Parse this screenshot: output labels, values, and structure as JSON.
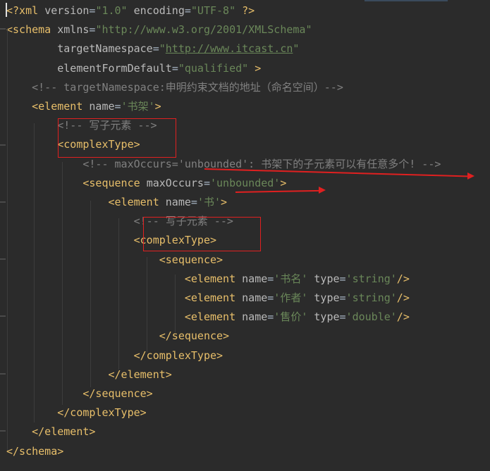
{
  "editor": {
    "language": "xml",
    "lines": [
      {
        "parts": [
          {
            "t": "<?xml ",
            "c": "pi"
          },
          {
            "t": "version",
            "c": "attr"
          },
          {
            "t": "=",
            "c": "plain"
          },
          {
            "t": "\"1.0\"",
            "c": "val"
          },
          {
            "t": " encoding",
            "c": "attr"
          },
          {
            "t": "=",
            "c": "plain"
          },
          {
            "t": "\"UTF-8\"",
            "c": "val"
          },
          {
            "t": " ?>",
            "c": "pi"
          }
        ]
      },
      {
        "parts": [
          {
            "t": "<schema ",
            "c": "tag"
          },
          {
            "t": "xmlns",
            "c": "attr"
          },
          {
            "t": "=",
            "c": "plain"
          },
          {
            "t": "\"http://www.w3.org/2001/XMLSchema\"",
            "c": "val"
          }
        ]
      },
      {
        "parts": [
          {
            "t": "        targetNamespace",
            "c": "attr"
          },
          {
            "t": "=",
            "c": "plain"
          },
          {
            "t": "\"",
            "c": "val"
          },
          {
            "t": "http://www.itcast.cn",
            "c": "link"
          },
          {
            "t": "\"",
            "c": "val"
          }
        ]
      },
      {
        "parts": [
          {
            "t": "        elementFormDefault",
            "c": "attr"
          },
          {
            "t": "=",
            "c": "plain"
          },
          {
            "t": "\"qualified\"",
            "c": "val"
          },
          {
            "t": " >",
            "c": "tag"
          }
        ]
      },
      {
        "parts": [
          {
            "t": "    <!-- targetNamespace:申明约束文档的地址（命名空间）-->",
            "c": "cmt"
          }
        ]
      },
      {
        "parts": [
          {
            "t": "    <element ",
            "c": "tag"
          },
          {
            "t": "name",
            "c": "attr"
          },
          {
            "t": "=",
            "c": "plain"
          },
          {
            "t": "'书架'",
            "c": "val"
          },
          {
            "t": ">",
            "c": "tag"
          }
        ]
      },
      {
        "parts": [
          {
            "t": "        <!-- 写子元素 -->",
            "c": "cmt"
          }
        ]
      },
      {
        "parts": [
          {
            "t": "        <complexType>",
            "c": "tag"
          }
        ]
      },
      {
        "parts": [
          {
            "t": "            <!-- maxOccurs='unbounded': 书架下的子元素可以有任意多个! -->",
            "c": "cmt"
          }
        ]
      },
      {
        "parts": [
          {
            "t": "            <sequence ",
            "c": "tag"
          },
          {
            "t": "maxOccurs",
            "c": "attr"
          },
          {
            "t": "=",
            "c": "plain"
          },
          {
            "t": "'unbounded'",
            "c": "val"
          },
          {
            "t": ">",
            "c": "tag"
          }
        ]
      },
      {
        "parts": [
          {
            "t": "                <element ",
            "c": "tag"
          },
          {
            "t": "name",
            "c": "attr"
          },
          {
            "t": "=",
            "c": "plain"
          },
          {
            "t": "'书'",
            "c": "val"
          },
          {
            "t": ">",
            "c": "tag"
          }
        ]
      },
      {
        "parts": [
          {
            "t": "                    <!-- 写子元素 -->",
            "c": "cmt"
          }
        ]
      },
      {
        "parts": [
          {
            "t": "                    <complexType>",
            "c": "tag"
          }
        ]
      },
      {
        "parts": [
          {
            "t": "                        <sequence>",
            "c": "tag"
          }
        ]
      },
      {
        "parts": [
          {
            "t": "                            <element ",
            "c": "tag"
          },
          {
            "t": "name",
            "c": "attr"
          },
          {
            "t": "=",
            "c": "plain"
          },
          {
            "t": "'书名'",
            "c": "val"
          },
          {
            "t": " type",
            "c": "attr"
          },
          {
            "t": "=",
            "c": "plain"
          },
          {
            "t": "'string'",
            "c": "val"
          },
          {
            "t": "/>",
            "c": "tag"
          }
        ]
      },
      {
        "parts": [
          {
            "t": "                            <element ",
            "c": "tag"
          },
          {
            "t": "name",
            "c": "attr"
          },
          {
            "t": "=",
            "c": "plain"
          },
          {
            "t": "'作者'",
            "c": "val"
          },
          {
            "t": " type",
            "c": "attr"
          },
          {
            "t": "=",
            "c": "plain"
          },
          {
            "t": "'string'",
            "c": "val"
          },
          {
            "t": "/>",
            "c": "tag"
          }
        ]
      },
      {
        "parts": [
          {
            "t": "                            <element ",
            "c": "tag"
          },
          {
            "t": "name",
            "c": "attr"
          },
          {
            "t": "=",
            "c": "plain"
          },
          {
            "t": "'售价'",
            "c": "val"
          },
          {
            "t": " type",
            "c": "attr"
          },
          {
            "t": "=",
            "c": "plain"
          },
          {
            "t": "'double'",
            "c": "val"
          },
          {
            "t": "/>",
            "c": "tag"
          }
        ]
      },
      {
        "parts": [
          {
            "t": "                        </sequence>",
            "c": "tag"
          }
        ]
      },
      {
        "parts": [
          {
            "t": "                    </complexType>",
            "c": "tag"
          }
        ]
      },
      {
        "parts": [
          {
            "t": "                </element>",
            "c": "tag"
          }
        ]
      },
      {
        "parts": [
          {
            "t": "            </sequence>",
            "c": "tag"
          }
        ]
      },
      {
        "parts": [
          {
            "t": "        </complexType>",
            "c": "tag"
          }
        ]
      },
      {
        "parts": [
          {
            "t": "    </element>",
            "c": "tag"
          }
        ]
      },
      {
        "parts": [
          {
            "t": "</schema>",
            "c": "tag"
          }
        ]
      }
    ]
  },
  "colors": {
    "background": "#2b2b2b",
    "tag": "#e8bf6a",
    "attribute": "#bababa",
    "value": "#6a8759",
    "comment": "#808080",
    "annotation": "#e02020"
  }
}
